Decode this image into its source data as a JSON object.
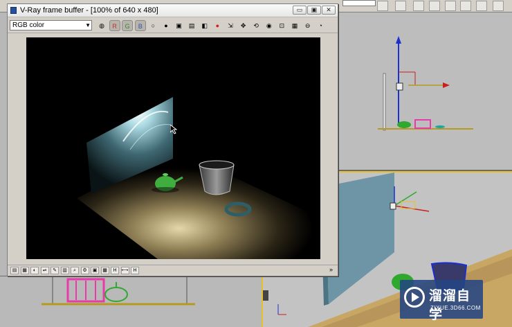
{
  "window": {
    "title": "V-Ray frame buffer - [100% of 640 x 480]",
    "minimize_glyph": "▭",
    "maximize_glyph": "▣",
    "close_glyph": "✕"
  },
  "toolbar": {
    "channel_selected": "RGB color",
    "tools": [
      {
        "name": "color-channels-icon",
        "label": "◍",
        "pressed": false
      },
      {
        "name": "red-channel-icon",
        "label": "R",
        "pressed": true,
        "color": "#c03030"
      },
      {
        "name": "green-channel-icon",
        "label": "G",
        "pressed": true,
        "color": "#2e8a2e"
      },
      {
        "name": "blue-channel-icon",
        "label": "B",
        "pressed": true,
        "color": "#3050b0"
      },
      {
        "name": "alpha-channel-icon",
        "label": "○",
        "pressed": false
      },
      {
        "name": "mono-channel-icon",
        "label": "●",
        "pressed": false
      },
      {
        "name": "save-image-icon",
        "label": "▣",
        "pressed": false
      },
      {
        "name": "load-image-icon",
        "label": "▤",
        "pressed": false
      },
      {
        "name": "clear-image-icon",
        "label": "◧",
        "pressed": false
      },
      {
        "name": "stop-render-icon",
        "label": "●",
        "pressed": false,
        "color": "#d02020"
      },
      {
        "name": "track-mouse-icon",
        "label": "⇲",
        "pressed": false
      },
      {
        "name": "region-render-icon",
        "label": "✥",
        "pressed": false
      },
      {
        "name": "render-last-icon",
        "label": "⟲",
        "pressed": false
      },
      {
        "name": "color-correction-icon",
        "label": "◉",
        "pressed": false
      },
      {
        "name": "display-correction-icon",
        "label": "⊡",
        "pressed": false
      },
      {
        "name": "pixel-info-icon",
        "label": "▦",
        "pressed": false
      },
      {
        "name": "lut-icon",
        "label": "⊖",
        "pressed": false
      },
      {
        "name": "history-icon",
        "label": "◔",
        "pressed": false
      }
    ]
  },
  "statusbar": {
    "tools": [
      "▤",
      "▦",
      "◐",
      "⇌",
      "✎",
      "▥",
      "⌕",
      "⚙",
      "▣",
      "▦",
      "H",
      "⟷",
      "H"
    ],
    "expand_glyph": "»"
  },
  "max_toolbar": {
    "dropdown_value": "",
    "icon_count": 12
  },
  "watermark": {
    "title": "溜溜自学",
    "url": "ZIXUE.3D66.COM"
  },
  "colors": {
    "vfb_bg": "#d4d0c8",
    "render_bg": "#000000",
    "floor": "#c8b07a",
    "teapot": "#3fae3f",
    "viewport_active_border": "#e8c12a"
  }
}
